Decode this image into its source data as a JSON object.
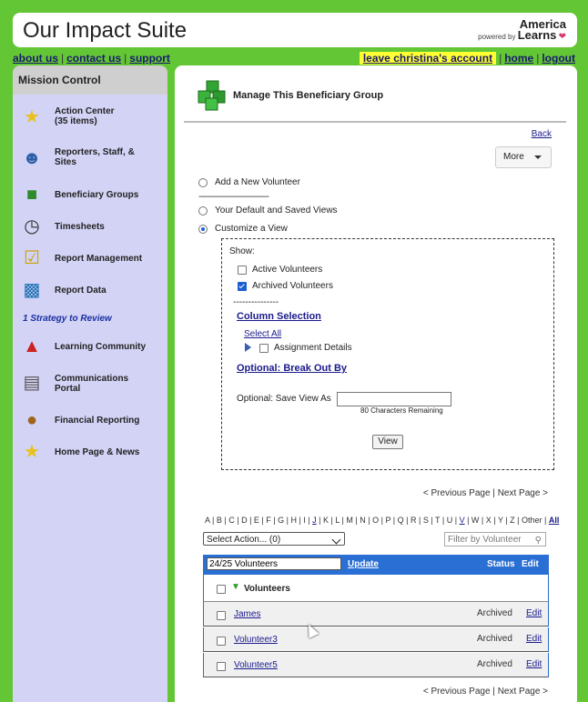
{
  "header": {
    "title": "Our Impact Suite",
    "brand_line1": "America",
    "brand_line2": "powered by",
    "brand_line3": "Learns"
  },
  "top_links": {
    "about": "about us",
    "contact": "contact us",
    "support": "support"
  },
  "right_links": {
    "leave": "leave christina's account",
    "home": "home",
    "logout": "logout"
  },
  "sidebar": {
    "title": "Mission Control",
    "items": [
      {
        "label": "Action Center",
        "sub": "(35 items)",
        "icon": "star-icon"
      },
      {
        "label": "Reporters, Staff, &",
        "sub": "Sites",
        "icon": "people-icon"
      },
      {
        "label": "Beneficiary Groups",
        "sub": "",
        "icon": "cubes-icon"
      },
      {
        "label": "Timesheets",
        "sub": "",
        "icon": "clock-icon"
      },
      {
        "label": "Report Management",
        "sub": "",
        "icon": "checklist-icon"
      },
      {
        "label": "Report Data",
        "sub": "",
        "icon": "chart-icon"
      },
      {
        "label": "Learning Community",
        "sub": "",
        "icon": "book-icon"
      },
      {
        "label": "Communications",
        "sub": "Portal",
        "icon": "newsletter-icon"
      },
      {
        "label": "Financial Reporting",
        "sub": "",
        "icon": "money-bag-icon"
      },
      {
        "label": "Home Page & News",
        "sub": "",
        "icon": "homepage-icon"
      }
    ],
    "strategy": "1 Strategy to Review"
  },
  "main": {
    "title": "Manage This Beneficiary Group",
    "back": "Back",
    "more": "More",
    "options": {
      "add": "Add a New Volunteer",
      "dashes": "---------------------------------",
      "saved": "Your Default and Saved Views",
      "customize": "Customize a View"
    },
    "customize": {
      "show": "Show:",
      "active": "Active Volunteers",
      "archived": "Archived Volunteers",
      "dashes": "---------------",
      "column_selection": "Column Selection",
      "select_all": "Select All",
      "assignment": "Assignment Details",
      "break_out": "Optional: Break Out By",
      "save_view_label": "Optional: Save View As",
      "remaining": "80 Characters Remaining",
      "view_button": "View"
    },
    "pager": {
      "prev": "< Previous Page",
      "sep": "|",
      "next": "Next Page >"
    },
    "alpha": [
      "A",
      "B",
      "C",
      "D",
      "E",
      "F",
      "G",
      "H",
      "I",
      "J",
      "K",
      "L",
      "M",
      "N",
      "O",
      "P",
      "Q",
      "R",
      "S",
      "T",
      "U",
      "V",
      "W",
      "X",
      "Y",
      "Z",
      "Other",
      "All"
    ],
    "select_action": "Select Action... (0)",
    "filter_placeholder": "Filter by Volunteer",
    "table": {
      "count": "24/25 Volunteers",
      "update": "Update",
      "status_header": "Status",
      "edit_header": "Edit",
      "group": "Volunteers",
      "rows": [
        {
          "name": "James",
          "status": "Archived",
          "edit": "Edit"
        },
        {
          "name": "Volunteer3",
          "status": "Archived",
          "edit": "Edit"
        },
        {
          "name": "Volunteer5",
          "status": "Archived",
          "edit": "Edit"
        }
      ]
    }
  }
}
